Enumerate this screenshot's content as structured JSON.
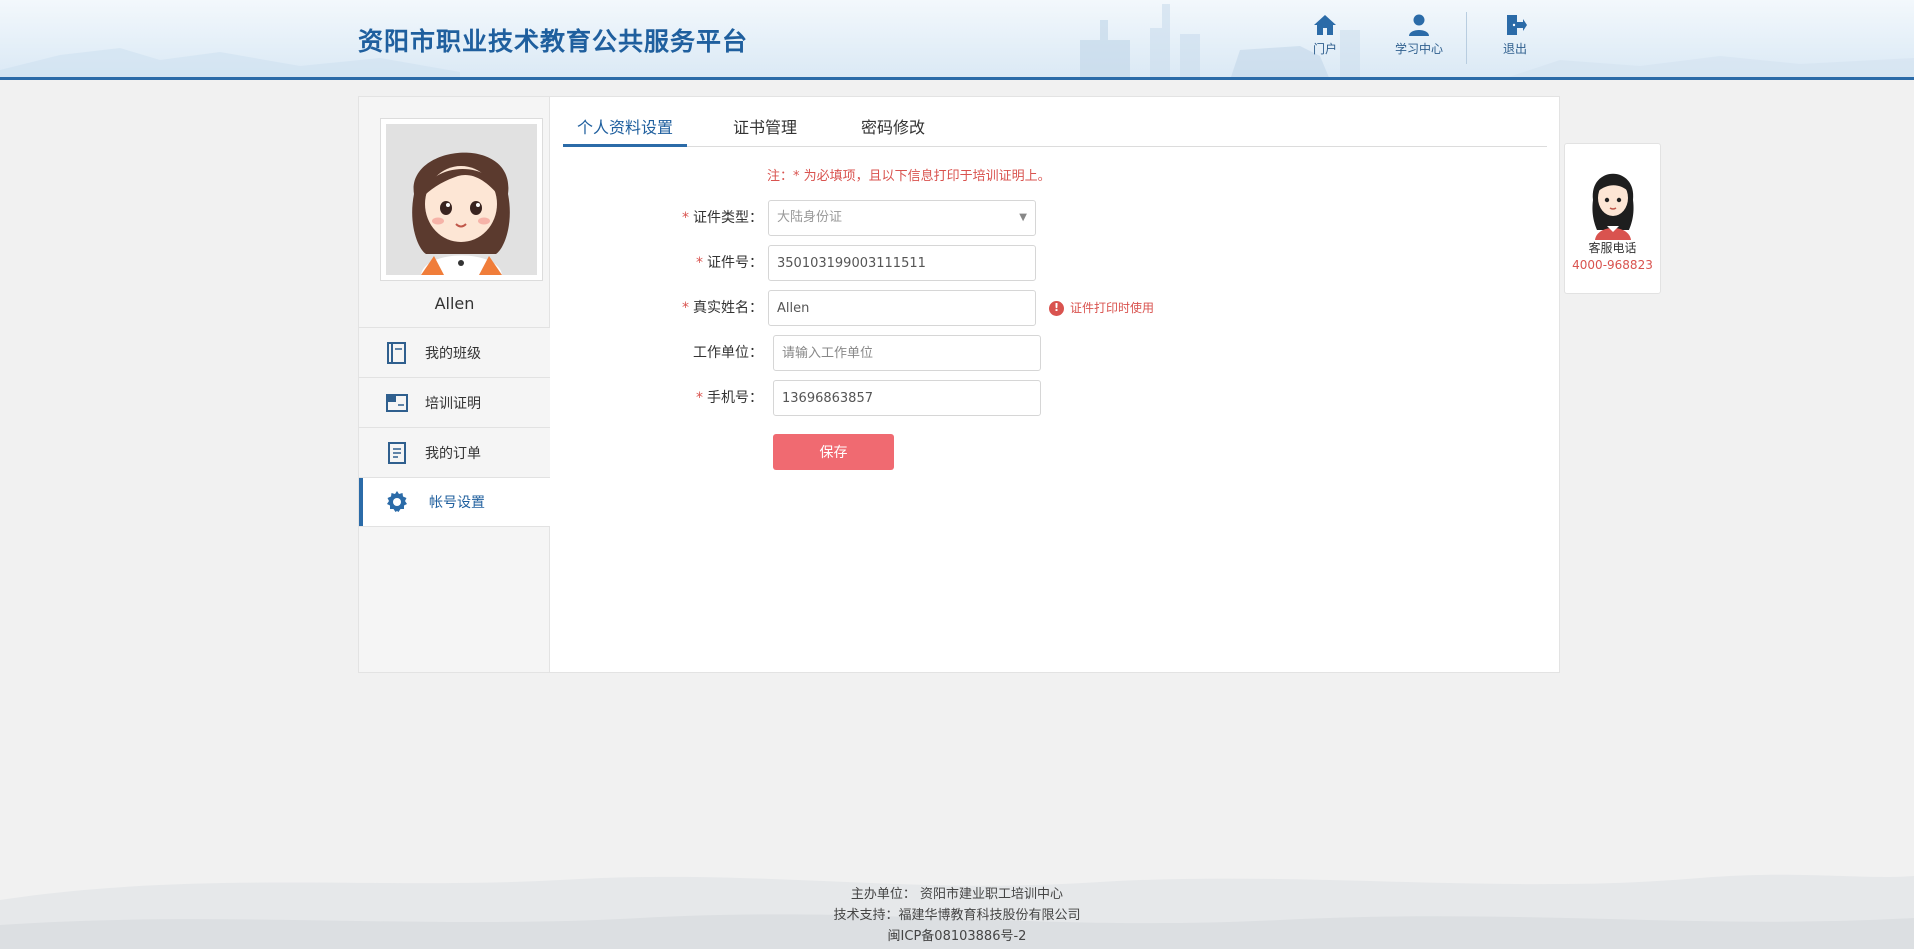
{
  "header": {
    "site_title": "资阳市职业技术教育公共服务平台",
    "nav": [
      {
        "label": "门户",
        "icon": "home-icon"
      },
      {
        "label": "学习中心",
        "icon": "user-icon"
      },
      {
        "label": "退出",
        "icon": "logout-icon"
      }
    ]
  },
  "sidebar": {
    "user_name": "Allen",
    "menu": [
      {
        "label": "我的班级",
        "icon": "book-icon",
        "active": false
      },
      {
        "label": "培训证明",
        "icon": "certificate-icon",
        "active": false
      },
      {
        "label": "我的订单",
        "icon": "order-icon",
        "active": false
      },
      {
        "label": "帐号设置",
        "icon": "gear-icon",
        "active": true
      }
    ]
  },
  "tabs": [
    {
      "label": "个人资料设置",
      "active": true
    },
    {
      "label": "证书管理",
      "active": false
    },
    {
      "label": "密码修改",
      "active": false
    }
  ],
  "form": {
    "note": "注：* 为必填项，且以下信息打印于培训证明上。",
    "id_type": {
      "label": "证件类型：",
      "required": true,
      "value": "大陆身份证"
    },
    "id_number": {
      "label": "证件号：",
      "required": true,
      "value": "350103199003111511"
    },
    "real_name": {
      "label": "真实姓名：",
      "required": true,
      "value": "Allen",
      "hint": "证件打印时使用"
    },
    "work_unit": {
      "label": "工作单位：",
      "required": false,
      "value": "",
      "placeholder": "请输入工作单位"
    },
    "phone": {
      "label": "手机号：",
      "required": true,
      "value": "13696863857"
    },
    "save_label": "保存",
    "required_mark": "*"
  },
  "service": {
    "label": "客服电话",
    "phone": "4000-968823"
  },
  "footer": {
    "host": "主办单位： 资阳市建业职工培训中心",
    "support": "技术支持：福建华博教育科技股份有限公司",
    "icp": "闽ICP备08103886号-2"
  },
  "colors": {
    "brand": "#1f5f9e",
    "required": "#d9534f",
    "save_button": "#f06a71"
  }
}
